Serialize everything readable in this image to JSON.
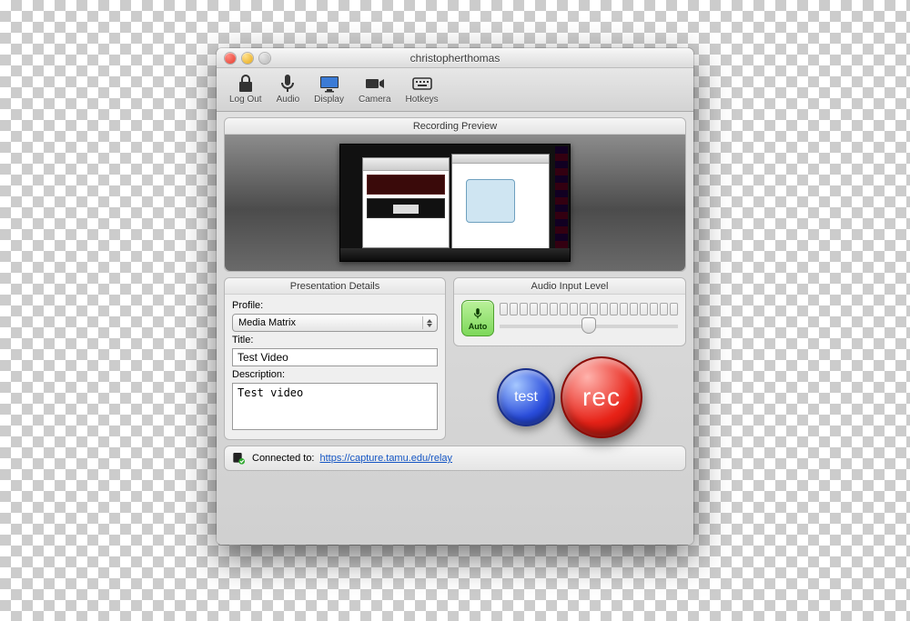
{
  "window": {
    "title": "christopherthomas"
  },
  "toolbar": {
    "logout": "Log Out",
    "audio": "Audio",
    "display": "Display",
    "camera": "Camera",
    "hotkeys": "Hotkeys"
  },
  "preview": {
    "title": "Recording Preview"
  },
  "details": {
    "title": "Presentation Details",
    "profile_label": "Profile:",
    "profile_value": "Media Matrix",
    "title_label": "Title:",
    "title_value": "Test Video",
    "description_label": "Description:",
    "description_value": "Test video"
  },
  "audio": {
    "title": "Audio Input Level",
    "auto_label": "Auto"
  },
  "buttons": {
    "test": "test",
    "rec": "rec"
  },
  "status": {
    "label": "Connected to:",
    "url": "https://capture.tamu.edu/relay"
  }
}
